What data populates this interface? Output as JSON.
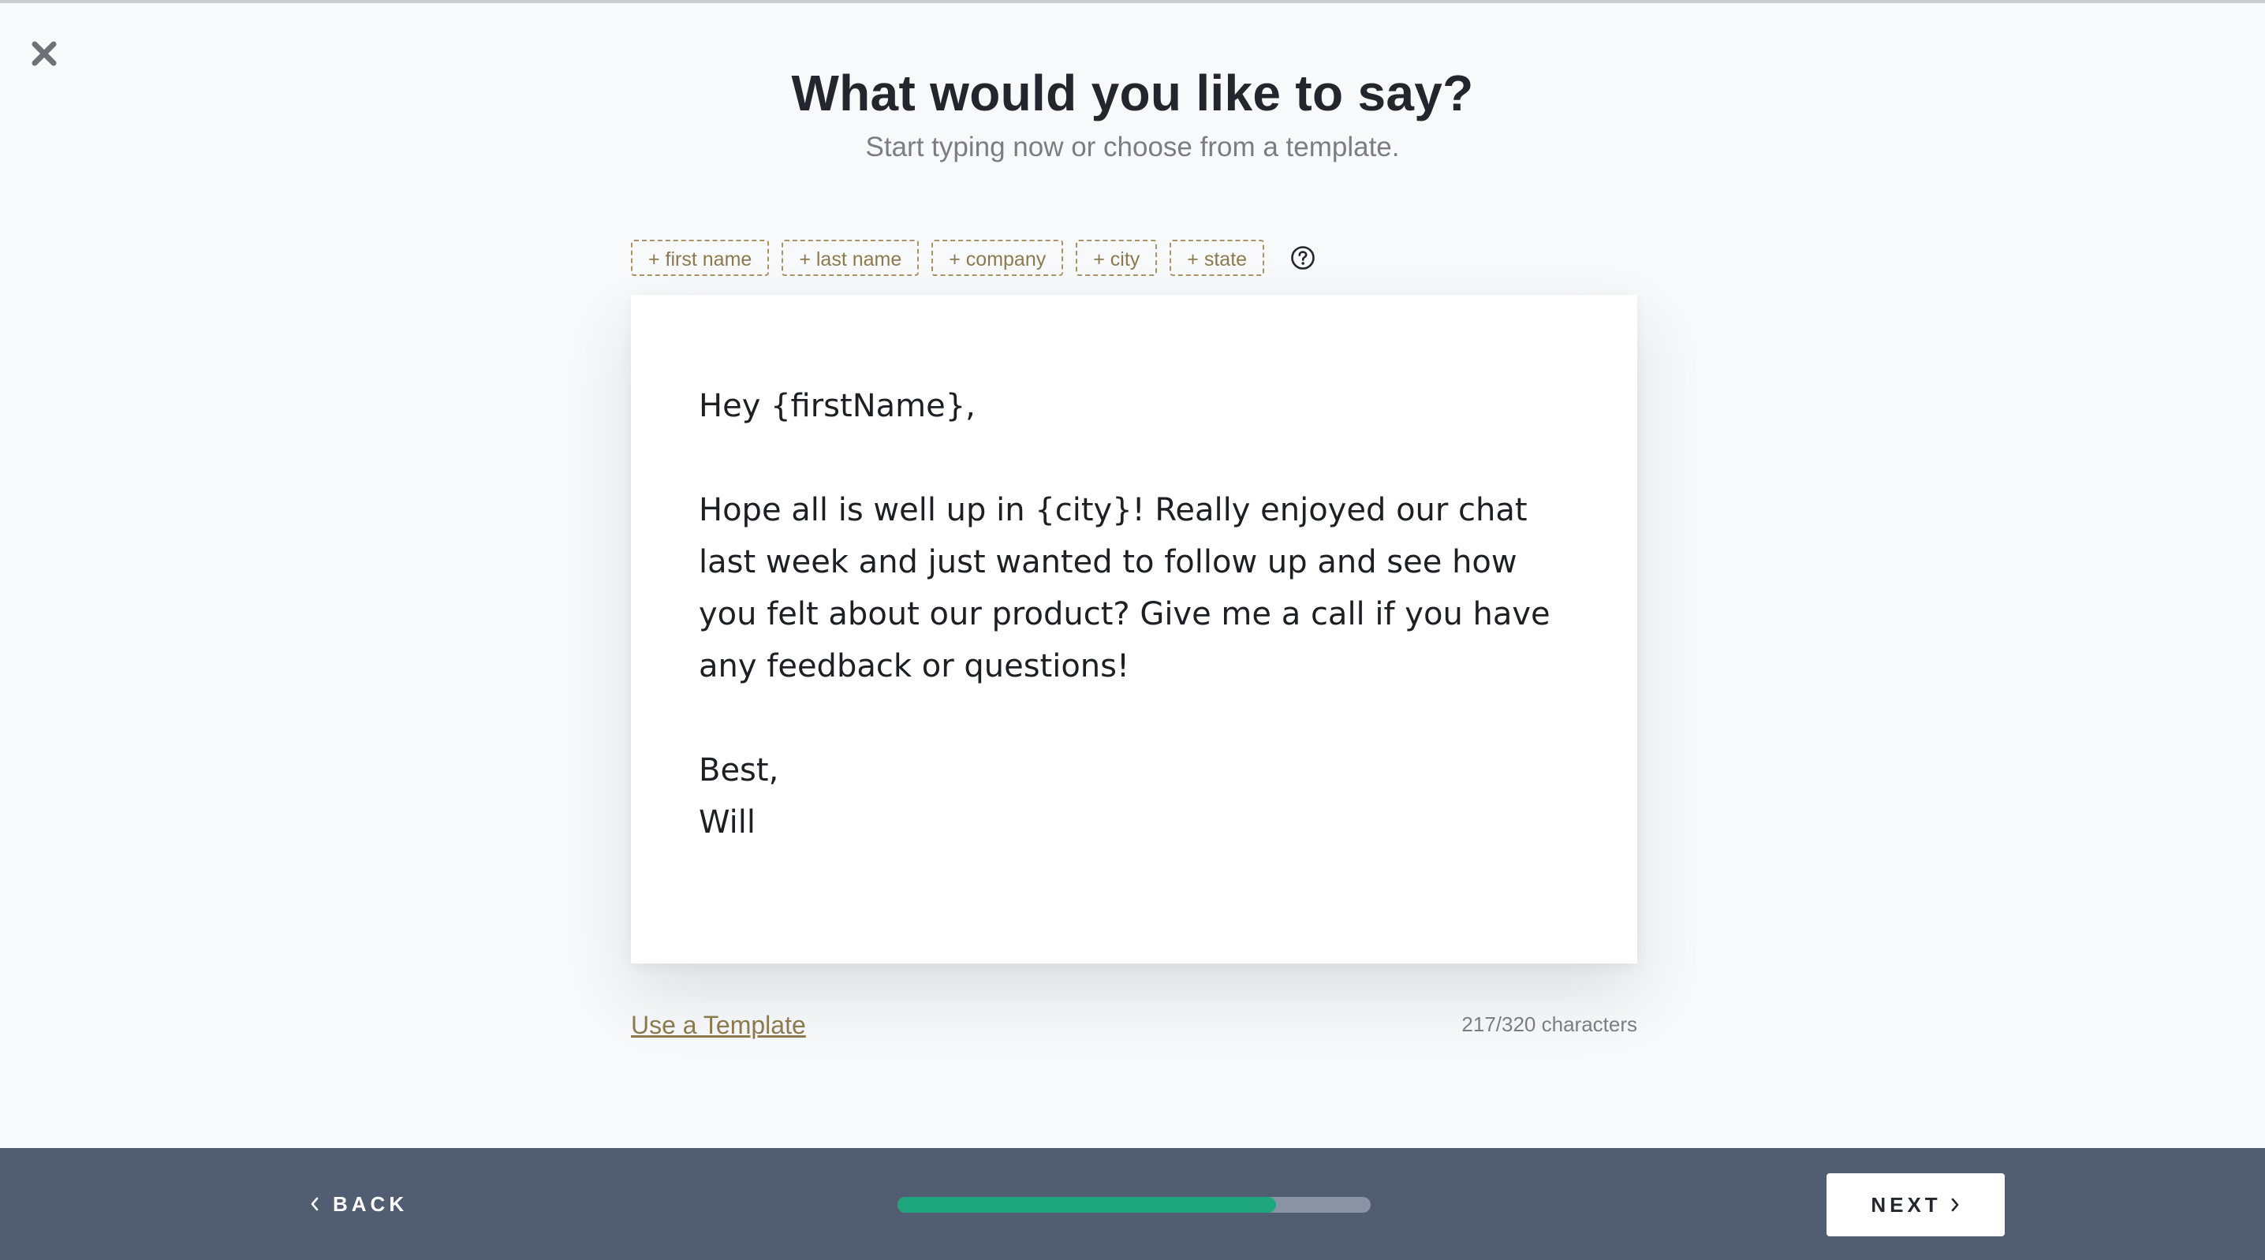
{
  "header": {
    "title": "What would you like to say?",
    "subtitle": "Start typing now or choose from a template."
  },
  "tokens": [
    {
      "label": "+ first name"
    },
    {
      "label": "+ last name"
    },
    {
      "label": "+ company"
    },
    {
      "label": "+ city"
    },
    {
      "label": "+ state"
    }
  ],
  "icons": {
    "close": "close-icon",
    "help": "help-icon",
    "back": "chevron-left-icon",
    "next": "chevron-right-icon"
  },
  "message": {
    "value": "Hey {firstName},\n\nHope all is well up in {city}! Really enjoyed our chat last week and just wanted to follow up and see how you felt about our product? Give me a call if you have any feedback or questions!\n\nBest,\nWill"
  },
  "template_link": "Use a Template",
  "char_count": "217/320 characters",
  "footer": {
    "back_label": "BACK",
    "next_label": "NEXT",
    "progress": 0.8
  },
  "colors": {
    "accent_gold": "#a89468",
    "progress_fill": "#1ea67c",
    "footer_bg": "#515e72"
  }
}
